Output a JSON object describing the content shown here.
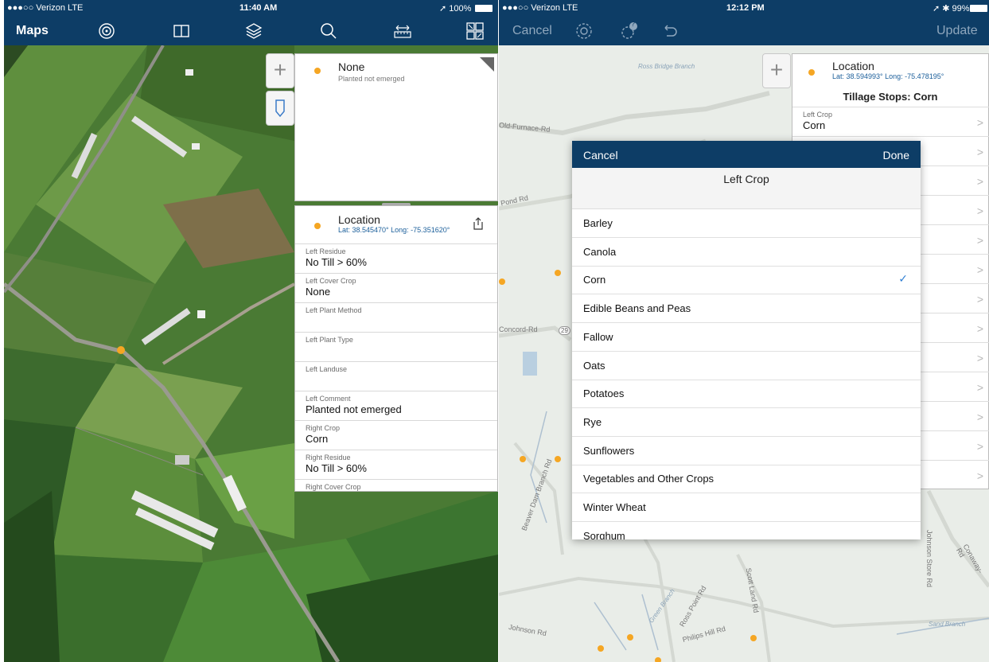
{
  "left": {
    "status": {
      "carrier": "●●●○○ Verizon  LTE",
      "time": "11:40 AM",
      "battery": "100%"
    },
    "nav": {
      "title": "Maps",
      "icons": [
        "target-icon",
        "book-icon",
        "layers-icon",
        "search-icon",
        "ruler-icon",
        "grid-scan-icon"
      ]
    },
    "tools": {
      "zoom_in": "+",
      "marker_icon": "marker-icon"
    },
    "top_card": {
      "title": "None",
      "subtitle": "Planted not emerged"
    },
    "location_card": {
      "title": "Location",
      "coords": "Lat: 38.545470° Long: -75.351620°",
      "fields": [
        {
          "label": "Left Residue",
          "value": "No Till  > 60%"
        },
        {
          "label": "Left Cover Crop",
          "value": "None"
        },
        {
          "label": "Left Plant Method",
          "value": ""
        },
        {
          "label": "Left Plant Type",
          "value": ""
        },
        {
          "label": "Left Landuse",
          "value": ""
        },
        {
          "label": "Left Comment",
          "value": "Planted not emerged"
        },
        {
          "label": "Right Crop",
          "value": "Corn"
        },
        {
          "label": "Right Residue",
          "value": "No Till  > 60%"
        },
        {
          "label": "Right Cover Crop",
          "value": ""
        }
      ]
    }
  },
  "right": {
    "status": {
      "carrier": "●●●○○ Verizon  LTE",
      "time": "12:12 PM",
      "battery": "99%"
    },
    "nav": {
      "cancel": "Cancel",
      "update": "Update",
      "badge": "?"
    },
    "map_labels": {
      "furnace": "Old-Furnace-Rd",
      "pond": "Pond Rd",
      "concord": "Concord-Rd",
      "route": "29",
      "johnson": "Johnson Rd",
      "philips": "Philips Hill Rd",
      "ross": "Ross Point Rd",
      "scott": "Scott Land Rd",
      "beaver": "Beaver Dam Branch Rd",
      "conaway": "Conaway-Rd",
      "johnson_st": "Johnson Store Rd",
      "ross_bridge": "Ross Bridge Branch",
      "green": "Green Branch",
      "sand": "Sand Branch"
    },
    "tillage": {
      "title": "Location",
      "coords": "Lat: 38.594993° Long: -75.478195°",
      "heading": "Tillage Stops: Corn",
      "first_label": "Left Crop",
      "first_value": "Corn"
    },
    "modal": {
      "cancel": "Cancel",
      "done": "Done",
      "title": "Left Crop",
      "options": [
        "Barley",
        "Canola",
        "Corn",
        "Edible Beans and Peas",
        "Fallow",
        "Oats",
        "Potatoes",
        "Rye",
        "Sunflowers",
        "Vegetables and Other Crops",
        "Winter Wheat",
        "Sorghum"
      ],
      "selected": "Corn",
      "check": "✓"
    }
  }
}
